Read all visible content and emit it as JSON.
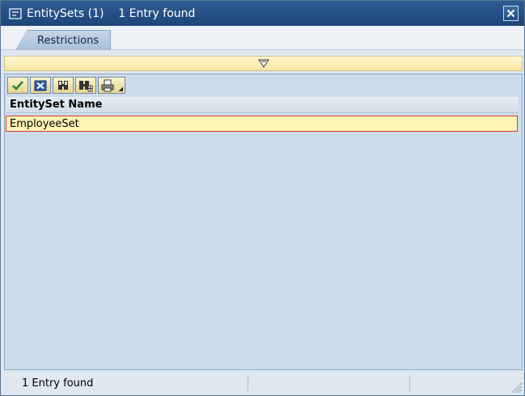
{
  "window": {
    "title": "EntitySets (1)    1 Entry found"
  },
  "tabs": [
    {
      "label": "Restrictions"
    }
  ],
  "table": {
    "column_header": "EntitySet Name",
    "rows": [
      "EmployeeSet"
    ]
  },
  "statusbar": {
    "text": "1 Entry found"
  },
  "icons": {
    "title": "input-help-icon",
    "close": "close-icon",
    "collapse": "filter-collapse-icon",
    "toolbar": [
      "checkmark-icon",
      "cancel-icon",
      "find-icon",
      "find-next-icon",
      "print-icon"
    ]
  },
  "colors": {
    "titlebar": "#244d82",
    "selection_border": "#d23a3a",
    "selection_fill": "#fff3b5",
    "content_bg": "#cddcea"
  }
}
